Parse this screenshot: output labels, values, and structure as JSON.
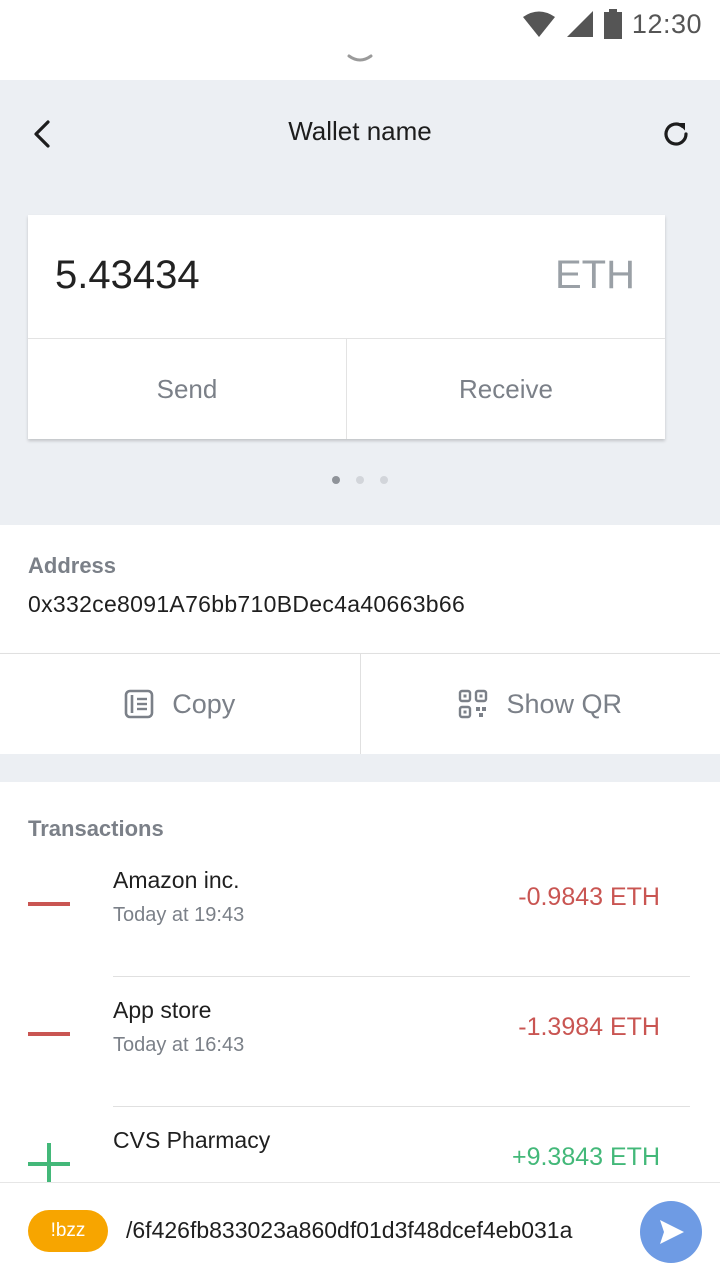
{
  "status_bar": {
    "time": "12:30",
    "icons": [
      "wifi-icon",
      "signal-icon",
      "battery-icon"
    ]
  },
  "header": {
    "title": "Wallet name",
    "back_icon": "chevron-left-icon",
    "refresh_icon": "refresh-icon"
  },
  "balance": {
    "amount": "5.43434",
    "unit": "ETH",
    "send_label": "Send",
    "receive_label": "Receive"
  },
  "pager": {
    "count": 3,
    "active": 0
  },
  "address": {
    "label": "Address",
    "value": "0x332ce8091A76bb710BDec4a40663b66",
    "copy_label": "Copy",
    "copy_icon": "copy-icon",
    "qr_label": "Show QR",
    "qr_icon": "qr-code-icon"
  },
  "transactions": {
    "header": "Transactions",
    "items": [
      {
        "name": "Amazon inc.",
        "time": "Today at 19:43",
        "amount": "-0.9843 ETH",
        "direction": "out"
      },
      {
        "name": "App store",
        "time": "Today at 16:43",
        "amount": "-1.3984 ETH",
        "direction": "out"
      },
      {
        "name": "CVS Pharmacy",
        "time": "",
        "amount": "+9.3843 ETH",
        "direction": "in"
      }
    ]
  },
  "input_bar": {
    "tag": "!bzz",
    "text": "/6f426fb833023a860df01d3f48dcef4eb031a",
    "send_icon": "send-icon"
  },
  "colors": {
    "accent_orange": "#f7a500",
    "send_blue": "#6e9be4",
    "negative": "#c95552",
    "positive": "#43b879",
    "panel_bg": "#eceff3"
  }
}
